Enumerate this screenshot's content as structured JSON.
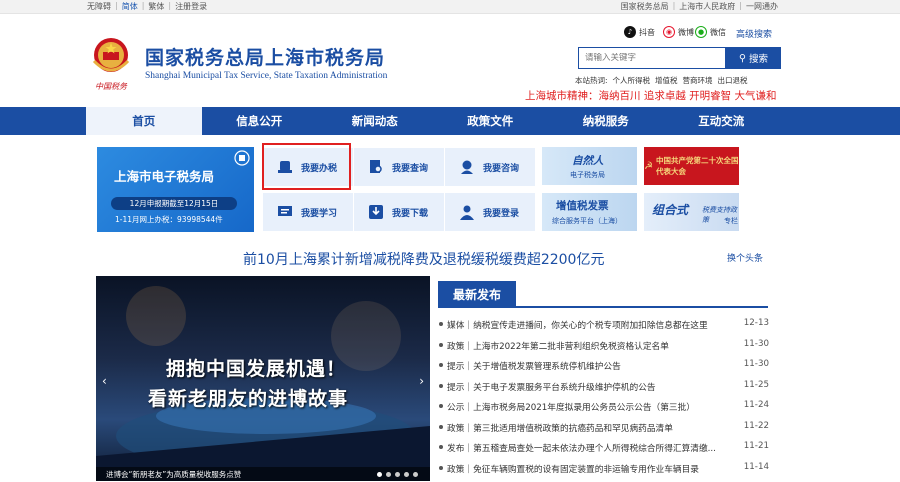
{
  "topbar": {
    "left": [
      "无障碍",
      "简体",
      "繁体",
      "注册登录"
    ],
    "right": [
      "国家税务总局",
      "上海市人民政府",
      "一网通办"
    ]
  },
  "header": {
    "title": "国家税务总局上海市税务局",
    "subtitle": "Shanghai Municipal Tax Service, State Taxation Administration",
    "emblem_caption": "中国税务",
    "social": [
      {
        "label": "抖音",
        "icon": "tiktok-icon"
      },
      {
        "label": "微博",
        "icon": "weibo-icon"
      },
      {
        "label": "微信",
        "icon": "wechat-icon"
      }
    ],
    "advanced_search": "高级搜索",
    "search_placeholder": "请输入关键字",
    "search_button": "搜索",
    "hot_label": "本站热词:",
    "hot_words": [
      "个人所得税",
      "增值税",
      "营商环境",
      "出口退税"
    ],
    "spirit": "上海城市精神：海纳百川 追求卓越 开明睿智 大气谦和"
  },
  "nav": {
    "items": [
      "首页",
      "信息公开",
      "新闻动态",
      "政策文件",
      "纳税服务",
      "互动交流"
    ],
    "active_index": 0
  },
  "etax": {
    "title": "上海市电子税务局",
    "deadline": "12月申报期截至12月15日",
    "count": "1-11月网上办税：93998544件"
  },
  "services": [
    {
      "label": "我要办税",
      "icon": "tax-handling-icon"
    },
    {
      "label": "我要查询",
      "icon": "search-doc-icon"
    },
    {
      "label": "我要咨询",
      "icon": "headset-icon"
    },
    {
      "label": "我要学习",
      "icon": "monitor-icon"
    },
    {
      "label": "我要下载",
      "icon": "download-icon"
    },
    {
      "label": "我要登录",
      "icon": "user-icon"
    }
  ],
  "promos": {
    "natural_person_a": "自然人",
    "natural_person_b": "电子税务局",
    "congress": "中国共产党第二十次全国代表大会",
    "vat_a": "增值税发票",
    "vat_b": "综合服务平台（上海）",
    "combo_a": "组合式",
    "combo_b": "税费支持政策",
    "combo_c": "专栏"
  },
  "headline": {
    "text": "前10月上海累计新增减税降费及退税缓税缓费超2200亿元",
    "more": "换个头条"
  },
  "slide": {
    "line1": "拥抱中国发展机遇！",
    "line2": "看新老朋友的进博故事",
    "caption": "进博会“新朋老友”为高质量税收服务点赞"
  },
  "news": {
    "title": "最新发布",
    "items": [
      {
        "text": "媒体｜纳税宣传走进播间，你关心的个税专项附加扣除信息都在这里",
        "date": "12-13"
      },
      {
        "text": "政策｜上海市2022年第二批非营利组织免税资格认定名单",
        "date": "11-30"
      },
      {
        "text": "提示｜关于增值税发票管理系统停机维护公告",
        "date": "11-30"
      },
      {
        "text": "提示｜关于电子发票服务平台系统升级维护停机的公告",
        "date": "11-25"
      },
      {
        "text": "公示｜上海市税务局2021年度拟录用公务员公示公告（第三批）",
        "date": "11-24"
      },
      {
        "text": "政策｜第三批适用增值税政策的抗癌药品和罕见病药品清单",
        "date": "11-22"
      },
      {
        "text": "发布｜第五稽查局查处一起未依法办理个人所得税综合所得汇算清缴...",
        "date": "11-21"
      },
      {
        "text": "政策｜免征车辆购置税的设有固定装置的非运输专用作业车辆目录",
        "date": "11-14"
      }
    ]
  }
}
